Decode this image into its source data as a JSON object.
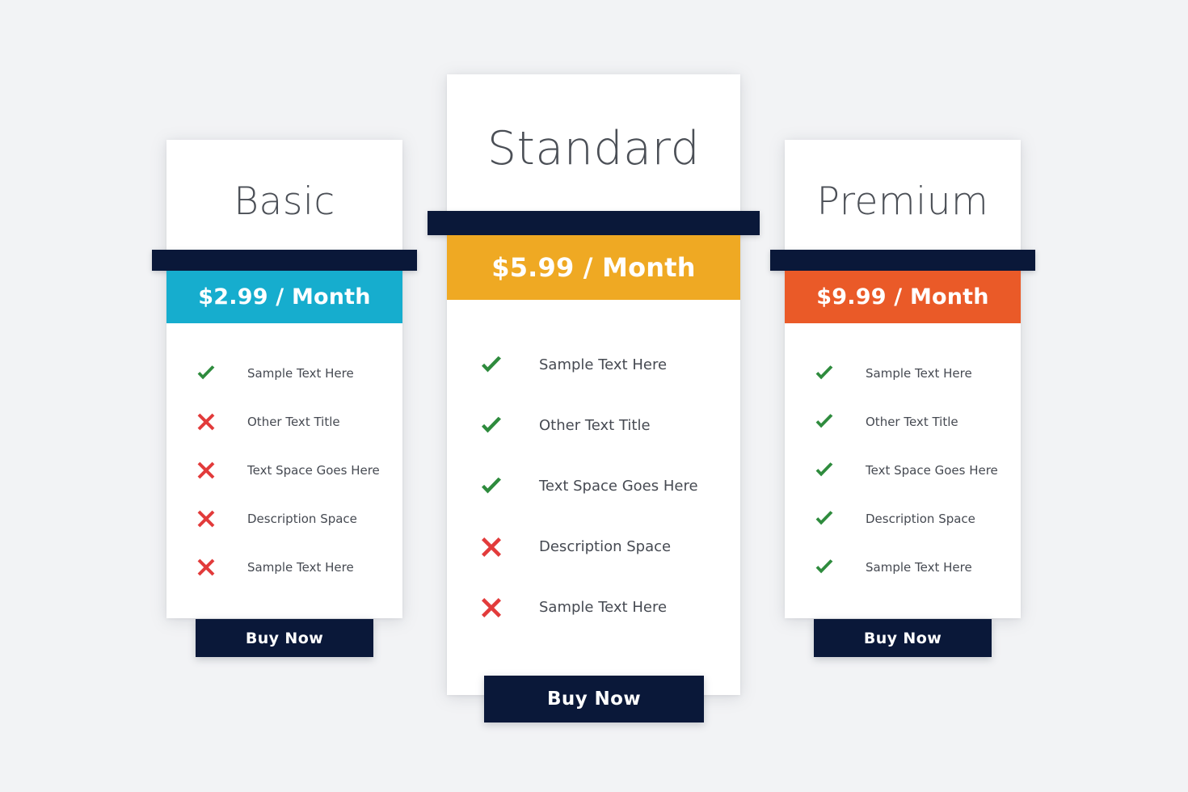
{
  "page": {
    "background_color": "#f2f3f5",
    "title": "Pricing Table"
  },
  "theme": {
    "navy": "#0a1839",
    "check_green": "#2e8b3d",
    "cross_red": "#e23b3b",
    "text_dark": "#464a52",
    "plan_name_color": "#4b4f56",
    "card_background": "#ffffff"
  },
  "plans": [
    {
      "id": "basic",
      "name": "Basic",
      "price": "$2.99 / Month",
      "accent_color": "#16adce",
      "featured": false,
      "buy_label": "Buy Now",
      "features": [
        {
          "label": "Sample Text Here",
          "included": true
        },
        {
          "label": "Other Text Title",
          "included": false
        },
        {
          "label": "Text Space Goes Here",
          "included": false
        },
        {
          "label": "Description Space",
          "included": false
        },
        {
          "label": "Sample Text Here",
          "included": false
        }
      ]
    },
    {
      "id": "standard",
      "name": "Standard",
      "price": "$5.99 / Month",
      "accent_color": "#efa923",
      "featured": true,
      "buy_label": "Buy Now",
      "features": [
        {
          "label": "Sample Text Here",
          "included": true
        },
        {
          "label": "Other Text Title",
          "included": true
        },
        {
          "label": "Text Space Goes Here",
          "included": true
        },
        {
          "label": "Description Space",
          "included": false
        },
        {
          "label": "Sample Text Here",
          "included": false
        }
      ]
    },
    {
      "id": "premium",
      "name": "Premium",
      "price": "$9.99 / Month",
      "accent_color": "#ea5a28",
      "featured": false,
      "buy_label": "Buy Now",
      "features": [
        {
          "label": "Sample Text Here",
          "included": true
        },
        {
          "label": "Other Text Title",
          "included": true
        },
        {
          "label": "Text Space Goes Here",
          "included": true
        },
        {
          "label": "Description Space",
          "included": true
        },
        {
          "label": "Sample Text Here",
          "included": true
        }
      ]
    }
  ],
  "icons": {
    "check": "check-icon",
    "cross": "cross-icon"
  }
}
